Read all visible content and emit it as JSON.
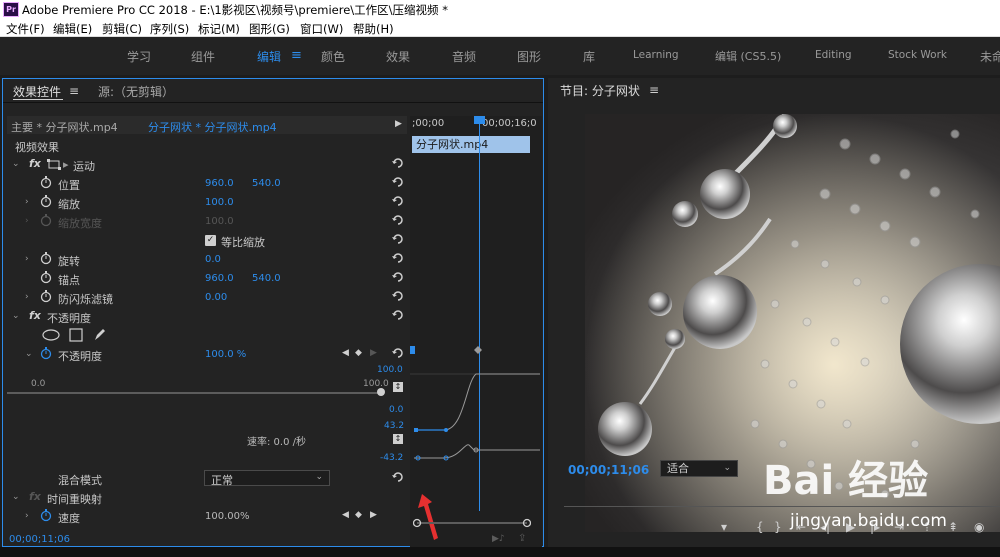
{
  "app": {
    "title": "Adobe Premiere Pro CC 2018 - E:\\1影视区\\视频号\\premiere\\工作区\\压缩视频 *",
    "logo": "Pr"
  },
  "menu": [
    "文件(F)",
    "编辑(E)",
    "剪辑(C)",
    "序列(S)",
    "标记(M)",
    "图形(G)",
    "窗口(W)",
    "帮助(H)"
  ],
  "workspaces": [
    "学习",
    "组件",
    "编辑",
    "颜色",
    "效果",
    "音频",
    "图形",
    "库",
    "Learning",
    "编辑 (CS5.5)",
    "Editing",
    "Stock Work",
    "未命"
  ],
  "workspaces_active": "编辑",
  "effect_controls": {
    "tab_label": "效果控件",
    "tab_source": "源:（无剪辑）",
    "source_master": "主要 * 分子网状.mp4",
    "source_clip": "分子网状 * 分子网状.mp4",
    "section_video": "视频效果",
    "motion": {
      "label": "运动",
      "position": {
        "label": "位置",
        "x": "960.0",
        "y": "540.0"
      },
      "scale": {
        "label": "缩放",
        "value": "100.0"
      },
      "scale_width": {
        "label": "缩放宽度",
        "value": "100.0"
      },
      "uniform": {
        "label": "等比缩放"
      },
      "rotation": {
        "label": "旋转",
        "value": "0.0"
      },
      "anchor": {
        "label": "锚点",
        "x": "960.0",
        "y": "540.0"
      },
      "antiflicker": {
        "label": "防闪烁滤镜",
        "value": "0.00"
      }
    },
    "opacity": {
      "label": "不透明度",
      "param": {
        "label": "不透明度",
        "value": "100.0 %"
      },
      "slider_min": "0.0",
      "slider_max": "100.0",
      "graph_top": "100.0",
      "graph_bottom": "0.0",
      "vel_top": "43.2",
      "vel_bottom": "-43.2",
      "rate": "速率: 0.0 /秒",
      "blend_label": "混合模式",
      "blend_value": "正常"
    },
    "time_remap": {
      "label": "时间重映射",
      "speed": {
        "label": "速度",
        "value": "100.00%"
      }
    },
    "timeline": {
      "start_tc": ";00;00",
      "end_tc": "00;00;16;0",
      "clip_name": "分子网状.mp4"
    },
    "current_tc": "00;00;11;06"
  },
  "program_monitor": {
    "title": "节目: 分子网状",
    "timecode": "00;00;11;06",
    "fit": "适合"
  },
  "watermark": {
    "brand": "Bai 经验",
    "url": "jingyan.baidu.com"
  },
  "colors": {
    "accent": "#2d8ceb",
    "panel_bg": "#232323",
    "clip": "#9fc3ea"
  }
}
